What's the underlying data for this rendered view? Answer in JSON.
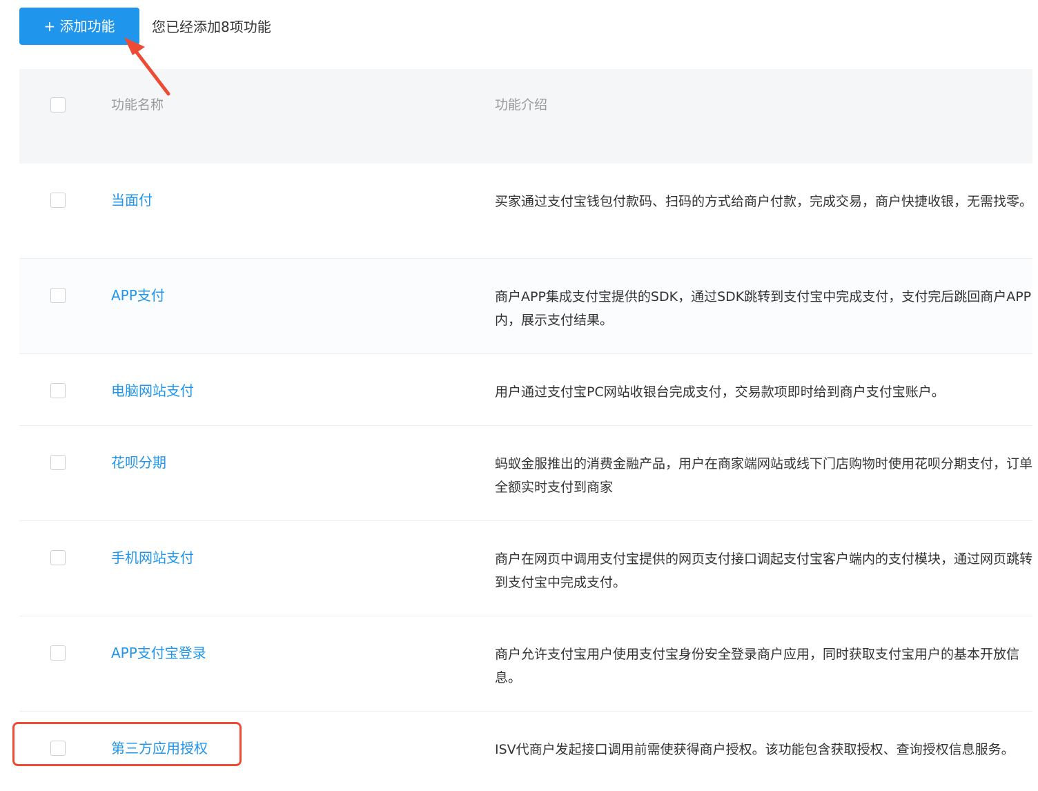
{
  "toolbar": {
    "add_button_label": "+ 添加功能",
    "added_count_text": "您已经添加8项功能"
  },
  "table": {
    "headers": {
      "name": "功能名称",
      "description": "功能介绍"
    },
    "rows": [
      {
        "name": "当面付",
        "description": "买家通过支付宝钱包付款码、扫码的方式给商户付款，完成交易，商户快捷收银，无需找零。"
      },
      {
        "name": "APP支付",
        "description": "商户APP集成支付宝提供的SDK，通过SDK跳转到支付宝中完成支付，支付完后跳回商户APP内，展示支付结果。"
      },
      {
        "name": "电脑网站支付",
        "description": "用户通过支付宝PC网站收银台完成支付，交易款项即时给到商户支付宝账户。"
      },
      {
        "name": "花呗分期",
        "description": "蚂蚁金服推出的消费金融产品，用户在商家端网站或线下门店购物时使用花呗分期支付，订单全额实时支付到商家"
      },
      {
        "name": "手机网站支付",
        "description": "商户在网页中调用支付宝提供的网页支付接口调起支付宝客户端内的支付模块，通过网页跳转到支付宝中完成支付。"
      },
      {
        "name": "APP支付宝登录",
        "description": "商户允许支付宝用户使用支付宝身份安全登录商户应用，同时获取支付宝用户的基本开放信息。"
      },
      {
        "name": "第三方应用授权",
        "description": "ISV代商户发起接口调用前需使获得商户授权。该功能包含获取授权、查询授权信息服务。"
      }
    ]
  },
  "colors": {
    "accent": "#1f95ec",
    "annotation": "#ee4b35"
  },
  "annotations": {
    "arrow_icon": "red-arrow-icon",
    "highlight": "red-highlight-box"
  }
}
